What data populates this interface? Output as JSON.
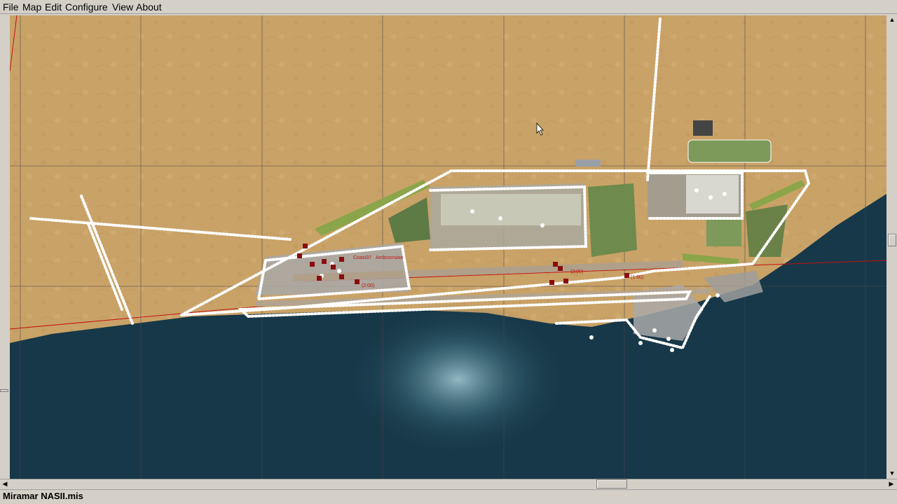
{
  "menu": {
    "file": "File",
    "map": "Map",
    "edit": "Edit",
    "configure": "Configure",
    "view": "View",
    "about": "About"
  },
  "status": {
    "filename": "Miramar NASII.mis"
  },
  "map": {
    "labels": [
      "Coast37",
      "Ambrocruise",
      "(2:00)",
      "(2:00)",
      "(1:60)"
    ]
  },
  "colors": {
    "desert": "#c9a267",
    "water": "#173848",
    "route": "#c21010",
    "object": "#ffffff"
  }
}
